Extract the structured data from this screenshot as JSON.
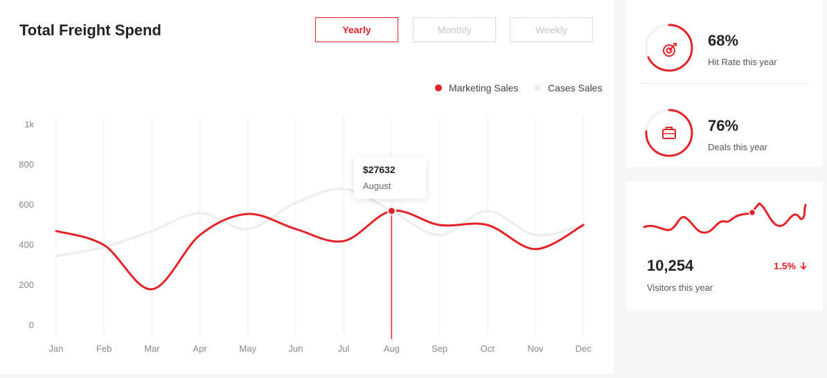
{
  "colors": {
    "accent": "#e52128",
    "secondary_line": "#eeeeee"
  },
  "title": "Total Freight Spend",
  "tabs": [
    {
      "label": "Yearly",
      "active": true
    },
    {
      "label": "Monthly",
      "active": false
    },
    {
      "label": "Weekly",
      "active": false
    }
  ],
  "tooltip": {
    "value": "$27632",
    "label": "August"
  },
  "chart_data": {
    "type": "line",
    "categories": [
      "Jan",
      "Feb",
      "Mar",
      "Apr",
      "May",
      "Jun",
      "Jul",
      "Aug",
      "Sep",
      "Oct",
      "Nov",
      "Dec"
    ],
    "yticks": [
      "0",
      "200",
      "400",
      "600",
      "800",
      "1k"
    ],
    "ylim": [
      0,
      1000
    ],
    "grid": "vertical",
    "legend_position": "top-right",
    "series": [
      {
        "name": "Marketing Sales",
        "color": "#e52128",
        "values": [
          470,
          400,
          180,
          450,
          555,
          480,
          420,
          570,
          500,
          500,
          380,
          500
        ]
      },
      {
        "name": "Cases Sales",
        "color": "#eeeeee",
        "values": [
          345,
          390,
          470,
          560,
          480,
          610,
          680,
          570,
          450,
          570,
          450,
          500
        ]
      }
    ],
    "highlight_index": 7
  },
  "stats": [
    {
      "value": "68%",
      "caption": "Hit Rate this year",
      "percent": 68,
      "icon": "target-icon"
    },
    {
      "value": "76%",
      "caption": "Deals this year",
      "percent": 76,
      "icon": "briefcase-icon"
    }
  ],
  "visitors": {
    "value": "10,254",
    "caption": "Visitors this year",
    "delta": "1.5%",
    "delta_direction": "down"
  }
}
